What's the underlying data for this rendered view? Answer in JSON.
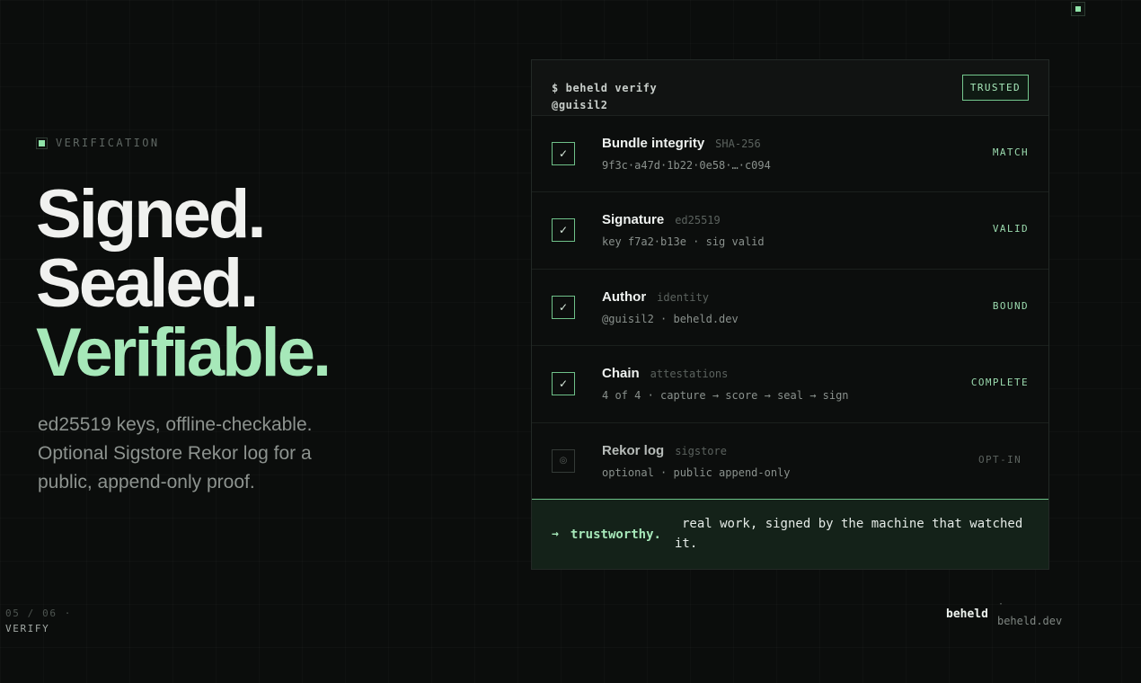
{
  "eyebrow": {
    "label": "VERIFICATION"
  },
  "headline": {
    "line1": "Signed.",
    "line2": "Sealed.",
    "line3": "Verifiable."
  },
  "lede": "ed25519 keys, offline-checkable. Optional Sigstore Rekor log for a public, append-only proof.",
  "card": {
    "command": "$ beheld verify",
    "user": "@guisil2",
    "badge": "TRUSTED",
    "rows": [
      {
        "name": "Bundle integrity",
        "tag": "SHA-256",
        "detail": "9f3c·a47d·1b22·0e58·…·c094",
        "status": "MATCH",
        "check": "✓"
      },
      {
        "name": "Signature",
        "tag": "ed25519",
        "detail": "key f7a2·b13e · sig valid",
        "status": "VALID",
        "check": "✓"
      },
      {
        "name": "Author",
        "tag": "identity",
        "detail": "@guisil2 · beheld.dev",
        "status": "BOUND",
        "check": "✓"
      },
      {
        "name": "Chain",
        "tag": "attestations",
        "detail": "4 of 4 · capture → score → seal → sign",
        "status": "COMPLETE",
        "check": "✓"
      },
      {
        "name": "Rekor log",
        "tag": "sigstore",
        "detail": "optional · public append-only",
        "status": "OPT-IN",
        "check": "◎"
      }
    ],
    "footer": {
      "arrow": "→",
      "key": "trustworthy.",
      "text": "real work, signed by the machine that watched it."
    }
  },
  "pager": {
    "count": "05 / 06 ·",
    "label": "VERIFY"
  },
  "brand": {
    "name": "beheld",
    "dot": "·",
    "url": "beheld.dev"
  },
  "colors": {
    "accent": "#a6e8b9",
    "background": "#0b0d0c",
    "footer_bg": "#142219"
  }
}
